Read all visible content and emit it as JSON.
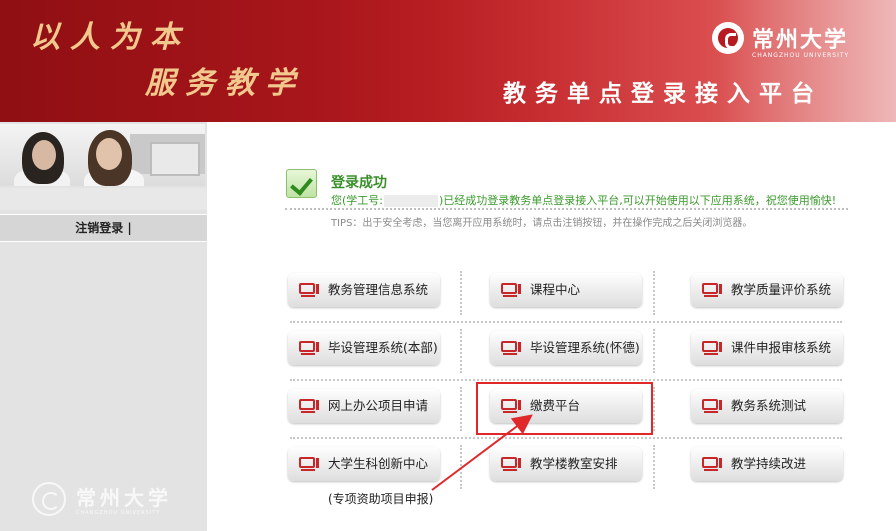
{
  "header": {
    "slogan_line1": "以人为本",
    "slogan_line2": "服务教学",
    "university_name": "常州大学",
    "university_en": "CHANGZHOU UNIVERSITY",
    "system_title": "教务单点登录接入平台"
  },
  "sidebar": {
    "logout_label": "注销登录 |",
    "footer_logo_name": "常州大学",
    "footer_logo_en": "CHANGZHOU UNIVERSITY"
  },
  "notice": {
    "title": "登录成功",
    "message_prefix": "您(学工号:",
    "message_suffix": ")已经成功登录教务单点登录接入平台,可以开始使用以下应用系统，祝您使用愉快!",
    "tips": "TIPS：出于安全考虑，当您离开应用系统时，请点击注销按钮，并在操作完成之后关闭浏览器。"
  },
  "apps": [
    {
      "label": "教务管理信息系统"
    },
    {
      "label": "课程中心"
    },
    {
      "label": "教学质量评价系统"
    },
    {
      "label": "毕设管理系统(本部)"
    },
    {
      "label": "毕设管理系统(怀德)"
    },
    {
      "label": "课件申报审核系统"
    },
    {
      "label": "网上办公项目申请"
    },
    {
      "label": "缴费平台"
    },
    {
      "label": "教务系统测试"
    },
    {
      "label": "大学生科创新中心"
    },
    {
      "label": "教学楼教室安排"
    },
    {
      "label": "教学持续改进"
    }
  ],
  "annotation": {
    "note": "(专项资助项目申报)",
    "highlight_color": "#e0282b"
  },
  "colors": {
    "header_red": "#a8161b",
    "success_green": "#3a8f2b",
    "icon_red": "#c8272a"
  }
}
